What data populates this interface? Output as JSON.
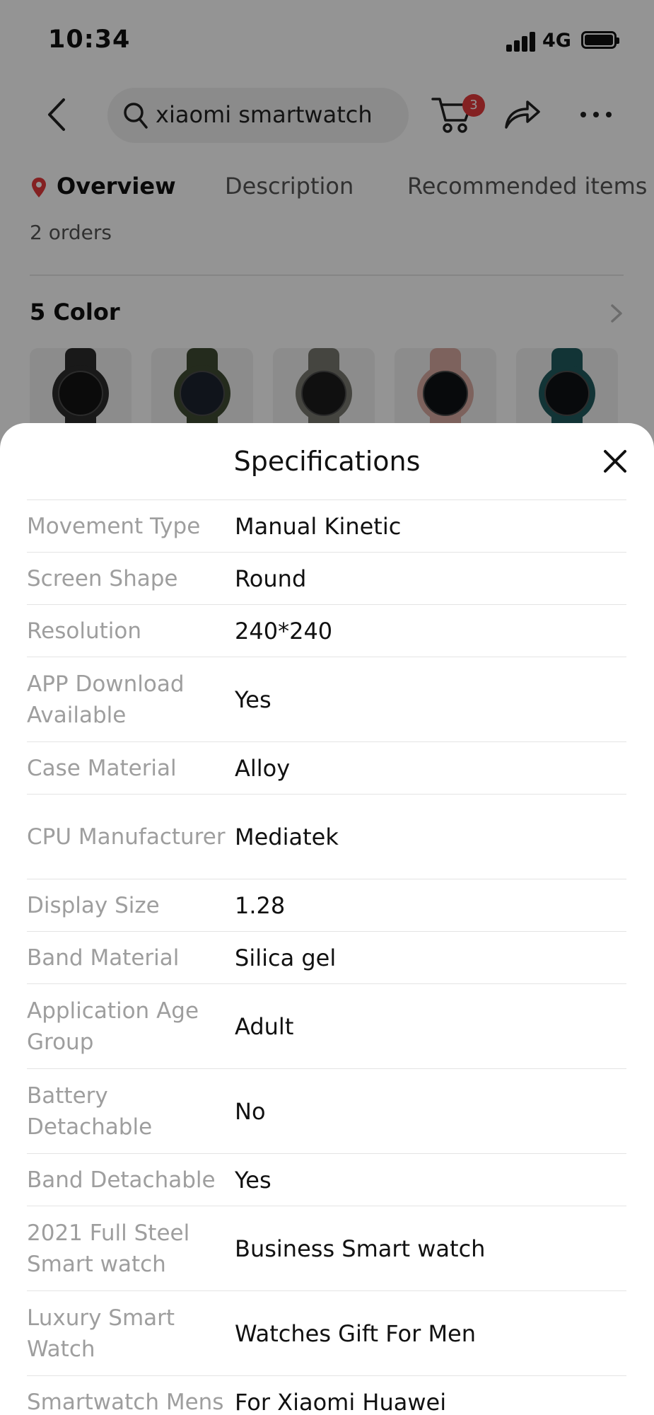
{
  "status_bar": {
    "time": "10:34",
    "network": "4G"
  },
  "header": {
    "search_text": "xiaomi smartwatch",
    "cart_badge": "3"
  },
  "tabs": [
    {
      "label": "Overview",
      "active": true
    },
    {
      "label": "Description",
      "active": false
    },
    {
      "label": "Recommended items",
      "active": false
    }
  ],
  "product": {
    "orders": "2 orders",
    "color_title": "5 Color",
    "swatches": [
      {
        "band": "#2b2b2b",
        "face": "#141414"
      },
      {
        "band": "#3f4a32",
        "face": "#1c2430"
      },
      {
        "band": "#77786f",
        "face": "#1d1d1d"
      },
      {
        "band": "#d8a9a0",
        "face": "#0e1216"
      },
      {
        "band": "#1f5a5d",
        "face": "#0e1216"
      }
    ]
  },
  "sheet": {
    "title": "Specifications",
    "specs": [
      {
        "label": "Movement Type",
        "value": "Manual Kinetic",
        "lines": 1
      },
      {
        "label": "Screen Shape",
        "value": "Round",
        "lines": 1
      },
      {
        "label": "Resolution",
        "value": "240*240",
        "lines": 1
      },
      {
        "label": "APP Download Available",
        "value": "Yes",
        "lines": 2
      },
      {
        "label": "Case Material",
        "value": "Alloy",
        "lines": 1
      },
      {
        "label": "CPU Manufacturer",
        "value": "Mediatek",
        "lines": 2
      },
      {
        "label": "Display Size",
        "value": "1.28",
        "lines": 1
      },
      {
        "label": "Band Material",
        "value": "Silica gel",
        "lines": 1
      },
      {
        "label": "Application Age Group",
        "value": "Adult",
        "lines": 2
      },
      {
        "label": "Battery Detachable",
        "value": "No",
        "lines": 2
      },
      {
        "label": "Band Detachable",
        "value": "Yes",
        "lines": 1
      },
      {
        "label": "2021 Full Steel Smart watch",
        "value": "Business Smart watch",
        "lines": 2
      },
      {
        "label": "Luxury Smart Watch",
        "value": "Watches Gift For Men",
        "lines": 2
      },
      {
        "label": "Smartwatch Mens",
        "value": "For Xiaomi Huawei",
        "lines": 1
      }
    ]
  },
  "colors": {
    "accent": "#e4393c",
    "overlay": "rgba(0,0,0,0.42)"
  },
  "icons": [
    "back-icon",
    "search-icon",
    "cart-icon",
    "share-icon",
    "more-icon",
    "location-pin-icon",
    "chevron-right-icon",
    "close-icon"
  ]
}
